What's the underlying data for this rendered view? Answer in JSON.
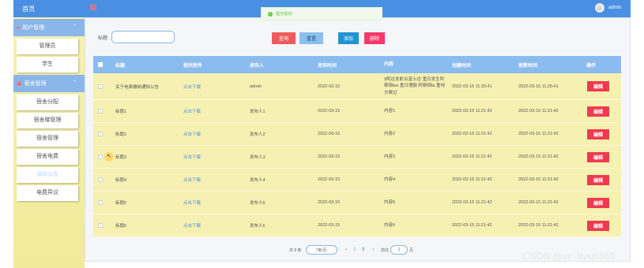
{
  "sidebar": {
    "home": "首页",
    "user_group": "用户管理",
    "user_items": [
      "管理员",
      "学生"
    ],
    "dorm_group": "宿舍管理",
    "dorm_items": [
      "宿舍分配",
      "宿舍楼管理",
      "宿舍管理",
      "宿舍电费",
      "通知公告",
      "电费异议"
    ]
  },
  "header": {
    "admin_name": "admin",
    "toast": "提交成功!"
  },
  "search": {
    "label": "标题",
    "value": "",
    "placeholder": ""
  },
  "buttons": {
    "query": "查询",
    "reset": "重置",
    "add": "添加",
    "delete": "删除"
  },
  "table": {
    "columns": [
      "标题",
      "相关附件",
      "发布人",
      "发布时间",
      "内容",
      "创建时间",
      "更新时间",
      "操作"
    ],
    "edit_label": "编辑",
    "rows": [
      {
        "title": "关于电费缴纳通知公告",
        "attachment": "点击下载",
        "publisher": "admin",
        "publish_date": "2022-03-15",
        "content": "9阿达发射点富士达 重日发生阿斯顿fas 重日理额 阿斯顿fa 重地方案过",
        "created": "2022-03-15 11:25:41",
        "updated": "2022-03-15 11:25:41"
      },
      {
        "title": "标题1",
        "attachment": "点击下载",
        "publisher": "发布人1",
        "publish_date": "2022-03-15",
        "content": "内容1",
        "created": "2022-03-15 11:21:42",
        "updated": "2022-03-15 11:21:42"
      },
      {
        "title": "标题2",
        "attachment": "点击下载",
        "publisher": "发布人2",
        "publish_date": "2022-03-15",
        "content": "内容2",
        "created": "2022-03-15 11:21:42",
        "updated": "2022-03-15 11:21:42"
      },
      {
        "title": "标题3",
        "attachment": "点击下载",
        "publisher": "发布人3",
        "publish_date": "2022-03-15",
        "content": "内容3",
        "created": "2022-03-15 11:21:42",
        "updated": "2022-03-15 11:21:42"
      },
      {
        "title": "标题4",
        "attachment": "点击下载",
        "publisher": "发布人4",
        "publish_date": "2022-03-15",
        "content": "内容4",
        "created": "2022-03-15 11:21:42",
        "updated": "2022-03-15 11:21:42"
      },
      {
        "title": "标题5",
        "attachment": "点击下载",
        "publisher": "发布人5",
        "publish_date": "2022-03-15",
        "content": "内容5",
        "created": "2022-03-15 11:21:42",
        "updated": "2022-03-15 11:21:42"
      },
      {
        "title": "标题6",
        "attachment": "点击下载",
        "publisher": "发布人6",
        "publish_date": "2022-03-15",
        "content": "内容6",
        "created": "2022-03-15 11:21:42",
        "updated": "2022-03-15 11:21:42"
      }
    ]
  },
  "pagination": {
    "total": "共 8 条",
    "page_size": "7条/页",
    "prev": "<",
    "pages": [
      "1",
      "2"
    ],
    "current": "1",
    "next": ">",
    "goto_label": "前往",
    "goto_value": "1",
    "page_unit": "页"
  },
  "watermark": "CSDN @vx_bysj6869"
}
